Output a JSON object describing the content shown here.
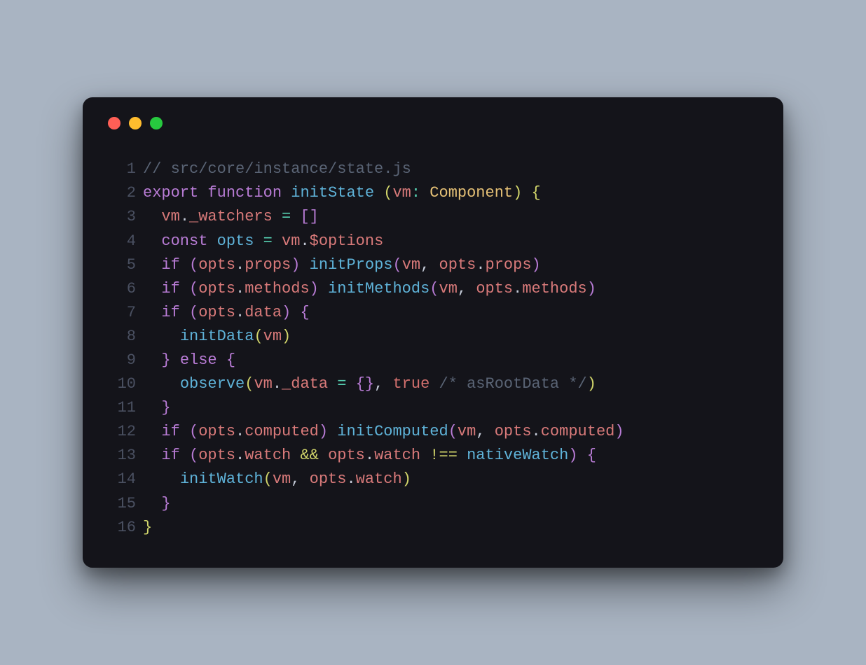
{
  "colors": {
    "bg": "#a9b4c2",
    "window": "#14141a",
    "red": "#ff5f56",
    "yellow": "#ffbd2e",
    "green": "#27c93f",
    "comment": "#5a6475",
    "keyword": "#b97cd6",
    "func": "#5fb3d9",
    "type": "#e6c176",
    "var": "#d97a7a",
    "punct": "#c5cbd8",
    "op": "#56d1b2",
    "accent": "#d2d66b",
    "bool": "#d3706e"
  },
  "code": {
    "lines": [
      {
        "num": "1",
        "tokens": [
          {
            "t": "// src/core/instance/state.js",
            "c": "comment"
          }
        ]
      },
      {
        "num": "2",
        "tokens": [
          {
            "t": "export",
            "c": "keyword"
          },
          {
            "t": " ",
            "c": "plain"
          },
          {
            "t": "function",
            "c": "keyword"
          },
          {
            "t": " ",
            "c": "plain"
          },
          {
            "t": "initState",
            "c": "func"
          },
          {
            "t": " ",
            "c": "plain"
          },
          {
            "t": "(",
            "c": "accent"
          },
          {
            "t": "vm",
            "c": "var"
          },
          {
            "t": ":",
            "c": "op"
          },
          {
            "t": " ",
            "c": "plain"
          },
          {
            "t": "Component",
            "c": "type"
          },
          {
            "t": ")",
            "c": "accent"
          },
          {
            "t": " ",
            "c": "plain"
          },
          {
            "t": "{",
            "c": "accent"
          }
        ]
      },
      {
        "num": "3",
        "tokens": [
          {
            "t": "  ",
            "c": "plain"
          },
          {
            "t": "vm",
            "c": "var"
          },
          {
            "t": ".",
            "c": "punct"
          },
          {
            "t": "_watchers",
            "c": "var"
          },
          {
            "t": " ",
            "c": "plain"
          },
          {
            "t": "=",
            "c": "op"
          },
          {
            "t": " ",
            "c": "plain"
          },
          {
            "t": "[",
            "c": "keyword"
          },
          {
            "t": "]",
            "c": "keyword"
          }
        ]
      },
      {
        "num": "4",
        "tokens": [
          {
            "t": "  ",
            "c": "plain"
          },
          {
            "t": "const",
            "c": "keyword"
          },
          {
            "t": " ",
            "c": "plain"
          },
          {
            "t": "opts",
            "c": "func"
          },
          {
            "t": " ",
            "c": "plain"
          },
          {
            "t": "=",
            "c": "op"
          },
          {
            "t": " ",
            "c": "plain"
          },
          {
            "t": "vm",
            "c": "var"
          },
          {
            "t": ".",
            "c": "punct"
          },
          {
            "t": "$options",
            "c": "var"
          }
        ]
      },
      {
        "num": "5",
        "tokens": [
          {
            "t": "  ",
            "c": "plain"
          },
          {
            "t": "if",
            "c": "keyword"
          },
          {
            "t": " ",
            "c": "plain"
          },
          {
            "t": "(",
            "c": "keyword"
          },
          {
            "t": "opts",
            "c": "var"
          },
          {
            "t": ".",
            "c": "punct"
          },
          {
            "t": "props",
            "c": "var"
          },
          {
            "t": ")",
            "c": "keyword"
          },
          {
            "t": " ",
            "c": "plain"
          },
          {
            "t": "initProps",
            "c": "func"
          },
          {
            "t": "(",
            "c": "keyword"
          },
          {
            "t": "vm",
            "c": "var"
          },
          {
            "t": ",",
            "c": "punct"
          },
          {
            "t": " ",
            "c": "plain"
          },
          {
            "t": "opts",
            "c": "var"
          },
          {
            "t": ".",
            "c": "punct"
          },
          {
            "t": "props",
            "c": "var"
          },
          {
            "t": ")",
            "c": "keyword"
          }
        ]
      },
      {
        "num": "6",
        "tokens": [
          {
            "t": "  ",
            "c": "plain"
          },
          {
            "t": "if",
            "c": "keyword"
          },
          {
            "t": " ",
            "c": "plain"
          },
          {
            "t": "(",
            "c": "keyword"
          },
          {
            "t": "opts",
            "c": "var"
          },
          {
            "t": ".",
            "c": "punct"
          },
          {
            "t": "methods",
            "c": "var"
          },
          {
            "t": ")",
            "c": "keyword"
          },
          {
            "t": " ",
            "c": "plain"
          },
          {
            "t": "initMethods",
            "c": "func"
          },
          {
            "t": "(",
            "c": "keyword"
          },
          {
            "t": "vm",
            "c": "var"
          },
          {
            "t": ",",
            "c": "punct"
          },
          {
            "t": " ",
            "c": "plain"
          },
          {
            "t": "opts",
            "c": "var"
          },
          {
            "t": ".",
            "c": "punct"
          },
          {
            "t": "methods",
            "c": "var"
          },
          {
            "t": ")",
            "c": "keyword"
          }
        ]
      },
      {
        "num": "7",
        "tokens": [
          {
            "t": "  ",
            "c": "plain"
          },
          {
            "t": "if",
            "c": "keyword"
          },
          {
            "t": " ",
            "c": "plain"
          },
          {
            "t": "(",
            "c": "keyword"
          },
          {
            "t": "opts",
            "c": "var"
          },
          {
            "t": ".",
            "c": "punct"
          },
          {
            "t": "data",
            "c": "var"
          },
          {
            "t": ")",
            "c": "keyword"
          },
          {
            "t": " ",
            "c": "plain"
          },
          {
            "t": "{",
            "c": "keyword"
          }
        ]
      },
      {
        "num": "8",
        "tokens": [
          {
            "t": "    ",
            "c": "plain"
          },
          {
            "t": "initData",
            "c": "func"
          },
          {
            "t": "(",
            "c": "accent"
          },
          {
            "t": "vm",
            "c": "var"
          },
          {
            "t": ")",
            "c": "accent"
          }
        ]
      },
      {
        "num": "9",
        "tokens": [
          {
            "t": "  ",
            "c": "plain"
          },
          {
            "t": "}",
            "c": "keyword"
          },
          {
            "t": " ",
            "c": "plain"
          },
          {
            "t": "else",
            "c": "keyword"
          },
          {
            "t": " ",
            "c": "plain"
          },
          {
            "t": "{",
            "c": "keyword"
          }
        ]
      },
      {
        "num": "10",
        "tokens": [
          {
            "t": "    ",
            "c": "plain"
          },
          {
            "t": "observe",
            "c": "func"
          },
          {
            "t": "(",
            "c": "accent"
          },
          {
            "t": "vm",
            "c": "var"
          },
          {
            "t": ".",
            "c": "punct"
          },
          {
            "t": "_data",
            "c": "var"
          },
          {
            "t": " ",
            "c": "plain"
          },
          {
            "t": "=",
            "c": "op"
          },
          {
            "t": " ",
            "c": "plain"
          },
          {
            "t": "{",
            "c": "keyword"
          },
          {
            "t": "}",
            "c": "keyword"
          },
          {
            "t": ",",
            "c": "punct"
          },
          {
            "t": " ",
            "c": "plain"
          },
          {
            "t": "true",
            "c": "bool"
          },
          {
            "t": " ",
            "c": "plain"
          },
          {
            "t": "/* asRootData */",
            "c": "comment"
          },
          {
            "t": ")",
            "c": "accent"
          }
        ]
      },
      {
        "num": "11",
        "tokens": [
          {
            "t": "  ",
            "c": "plain"
          },
          {
            "t": "}",
            "c": "keyword"
          }
        ]
      },
      {
        "num": "12",
        "tokens": [
          {
            "t": "  ",
            "c": "plain"
          },
          {
            "t": "if",
            "c": "keyword"
          },
          {
            "t": " ",
            "c": "plain"
          },
          {
            "t": "(",
            "c": "keyword"
          },
          {
            "t": "opts",
            "c": "var"
          },
          {
            "t": ".",
            "c": "punct"
          },
          {
            "t": "computed",
            "c": "var"
          },
          {
            "t": ")",
            "c": "keyword"
          },
          {
            "t": " ",
            "c": "plain"
          },
          {
            "t": "initComputed",
            "c": "func"
          },
          {
            "t": "(",
            "c": "keyword"
          },
          {
            "t": "vm",
            "c": "var"
          },
          {
            "t": ",",
            "c": "punct"
          },
          {
            "t": " ",
            "c": "plain"
          },
          {
            "t": "opts",
            "c": "var"
          },
          {
            "t": ".",
            "c": "punct"
          },
          {
            "t": "computed",
            "c": "var"
          },
          {
            "t": ")",
            "c": "keyword"
          }
        ]
      },
      {
        "num": "13",
        "tokens": [
          {
            "t": "  ",
            "c": "plain"
          },
          {
            "t": "if",
            "c": "keyword"
          },
          {
            "t": " ",
            "c": "plain"
          },
          {
            "t": "(",
            "c": "keyword"
          },
          {
            "t": "opts",
            "c": "var"
          },
          {
            "t": ".",
            "c": "punct"
          },
          {
            "t": "watch",
            "c": "var"
          },
          {
            "t": " ",
            "c": "plain"
          },
          {
            "t": "&&",
            "c": "accent"
          },
          {
            "t": " ",
            "c": "plain"
          },
          {
            "t": "opts",
            "c": "var"
          },
          {
            "t": ".",
            "c": "punct"
          },
          {
            "t": "watch",
            "c": "var"
          },
          {
            "t": " ",
            "c": "plain"
          },
          {
            "t": "!==",
            "c": "accent"
          },
          {
            "t": " ",
            "c": "plain"
          },
          {
            "t": "nativeWatch",
            "c": "func"
          },
          {
            "t": ")",
            "c": "keyword"
          },
          {
            "t": " ",
            "c": "plain"
          },
          {
            "t": "{",
            "c": "keyword"
          }
        ]
      },
      {
        "num": "14",
        "tokens": [
          {
            "t": "    ",
            "c": "plain"
          },
          {
            "t": "initWatch",
            "c": "func"
          },
          {
            "t": "(",
            "c": "accent"
          },
          {
            "t": "vm",
            "c": "var"
          },
          {
            "t": ",",
            "c": "punct"
          },
          {
            "t": " ",
            "c": "plain"
          },
          {
            "t": "opts",
            "c": "var"
          },
          {
            "t": ".",
            "c": "punct"
          },
          {
            "t": "watch",
            "c": "var"
          },
          {
            "t": ")",
            "c": "accent"
          }
        ]
      },
      {
        "num": "15",
        "tokens": [
          {
            "t": "  ",
            "c": "plain"
          },
          {
            "t": "}",
            "c": "keyword"
          }
        ]
      },
      {
        "num": "16",
        "tokens": [
          {
            "t": "}",
            "c": "accent"
          }
        ]
      }
    ]
  }
}
